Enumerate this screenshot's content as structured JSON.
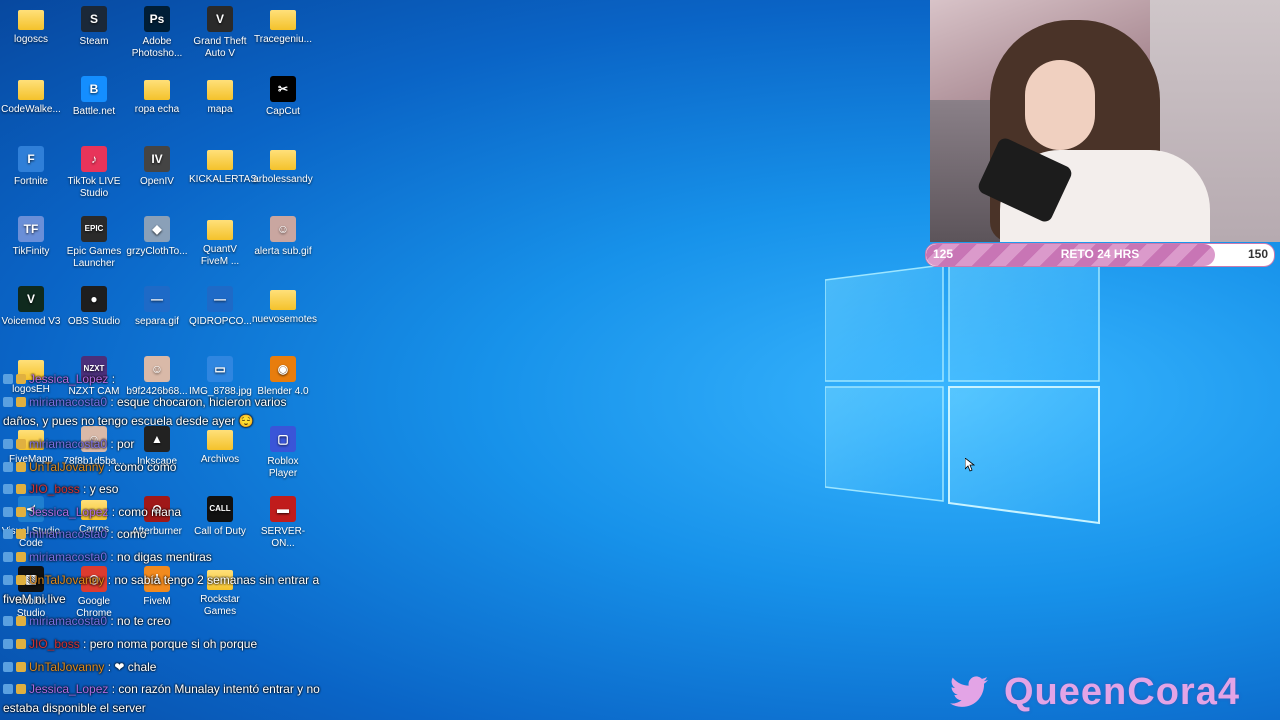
{
  "desktop_icons": [
    {
      "label": "logoscs",
      "type": "folder"
    },
    {
      "label": "Steam",
      "type": "app",
      "color": "#1b2838",
      "glyph": "S"
    },
    {
      "label": "Adobe Photosho...",
      "type": "app",
      "color": "#001e36",
      "glyph": "Ps"
    },
    {
      "label": "Grand Theft Auto V",
      "type": "app",
      "color": "#2a2a2a",
      "glyph": "V"
    },
    {
      "label": "Tracegeniu...",
      "type": "folder"
    },
    {
      "label": "CodeWalke...",
      "type": "folder"
    },
    {
      "label": "Battle.net",
      "type": "app",
      "color": "#148eff",
      "glyph": "B"
    },
    {
      "label": "ropa echa",
      "type": "folder"
    },
    {
      "label": "mapa",
      "type": "folder"
    },
    {
      "label": "CapCut",
      "type": "app",
      "color": "#000000",
      "glyph": "✂"
    },
    {
      "label": "Fortnite",
      "type": "app",
      "color": "#2f7fd8",
      "glyph": "F"
    },
    {
      "label": "TikTok LIVE Studio",
      "type": "app",
      "color": "#e8345a",
      "glyph": "♪"
    },
    {
      "label": "OpenIV",
      "type": "app",
      "color": "#444444",
      "glyph": "IV"
    },
    {
      "label": "KICKALERTAS",
      "type": "folder"
    },
    {
      "label": "arbolessandy",
      "type": "folder"
    },
    {
      "label": "TikFinity",
      "type": "app",
      "color": "#6a8fd8",
      "glyph": "TF"
    },
    {
      "label": "Epic Games Launcher",
      "type": "app",
      "color": "#2a2a2a",
      "glyph": "EPIC"
    },
    {
      "label": "grzyClothTo...",
      "type": "app",
      "color": "#8aa0b8",
      "glyph": "◆"
    },
    {
      "label": "QuantV FiveM ...",
      "type": "folder"
    },
    {
      "label": "alerta sub.gif",
      "type": "app",
      "color": "#c9a6a0",
      "glyph": "☺"
    },
    {
      "label": "Voicemod V3",
      "type": "app",
      "color": "#0f2a1e",
      "glyph": "V"
    },
    {
      "label": "OBS Studio",
      "type": "app",
      "color": "#1e1e1e",
      "glyph": "●"
    },
    {
      "label": "separa.gif",
      "type": "app",
      "color": "#1e6ac7",
      "glyph": "—"
    },
    {
      "label": "QIDROPCO...",
      "type": "app",
      "color": "#1e6ac7",
      "glyph": "—"
    },
    {
      "label": "nuevosemotes",
      "type": "folder"
    },
    {
      "label": "logosEH",
      "type": "folder"
    },
    {
      "label": "NZXT CAM",
      "type": "app",
      "color": "#4b2f7a",
      "glyph": "NZXT"
    },
    {
      "label": "b9f2426b68...",
      "type": "app",
      "color": "#d9b9a8",
      "glyph": "☺"
    },
    {
      "label": "IMG_8788.jpg",
      "type": "app",
      "color": "#2f86e0",
      "glyph": "▭"
    },
    {
      "label": "Blender 4.0",
      "type": "app",
      "color": "#e87d0d",
      "glyph": "◉"
    },
    {
      "label": "FiveMapp",
      "type": "folder"
    },
    {
      "label": "78f8b1d5ba...",
      "type": "app",
      "color": "#d9b9a8",
      "glyph": "☺"
    },
    {
      "label": "Inkscape",
      "type": "app",
      "color": "#222222",
      "glyph": "▲"
    },
    {
      "label": "Archivos",
      "type": "folder"
    },
    {
      "label": "Roblox Player",
      "type": "app",
      "color": "#3a55d8",
      "glyph": "▢"
    },
    {
      "label": "Visual Studio Code",
      "type": "app",
      "color": "#1f7fd0",
      "glyph": "≺"
    },
    {
      "label": "Carros",
      "type": "folder"
    },
    {
      "label": "Afterburner",
      "type": "app",
      "color": "#a01818",
      "glyph": "⊙"
    },
    {
      "label": "Call of Duty",
      "type": "app",
      "color": "#111111",
      "glyph": "CALL"
    },
    {
      "label": "SERVER-ON...",
      "type": "app",
      "color": "#c01c1c",
      "glyph": "▬"
    },
    {
      "label": "Roblox Studio",
      "type": "app",
      "color": "#111111",
      "glyph": "▧"
    },
    {
      "label": "Google Chrome",
      "type": "app",
      "color": "#dd3b2f",
      "glyph": "◎"
    },
    {
      "label": "FiveM",
      "type": "app",
      "color": "#f28a1e",
      "glyph": "⅄"
    },
    {
      "label": "Rockstar Games",
      "type": "folder"
    }
  ],
  "webcam": {
    "progress": {
      "current": "125",
      "label": "RETO 24 HRS",
      "goal": "150",
      "fraction": 0.83,
      "fill_color": "#c875b5"
    }
  },
  "chat": [
    {
      "user": "Jessica_Lopez",
      "text": " :",
      "user_class": "u-jess"
    },
    {
      "user": "miriamacosta0",
      "text": " : esque chocaron, hicieron varios",
      "user_class": "u-miriam"
    },
    {
      "user": "",
      "text": "daños, y pues no tengo escuela desde ayer 😌",
      "user_class": ""
    },
    {
      "user": "miriamacosta0",
      "text": " : por",
      "user_class": "u-miriam"
    },
    {
      "user": "UnTalJovanny",
      "text": " : como como",
      "user_class": "u-uni"
    },
    {
      "user": "JIO_boss",
      "text": " : y eso",
      "user_class": "u-jio"
    },
    {
      "user": "Jessica_Lopez",
      "text": " : como mana",
      "user_class": "u-jess"
    },
    {
      "user": "miriamacosta0",
      "text": " : como",
      "user_class": "u-miriam"
    },
    {
      "user": "miriamacosta0",
      "text": " : no digas mentiras",
      "user_class": "u-miriam"
    },
    {
      "user": "UnTalJovanny",
      "text": " : no sabía tengo 2 semanas sin entrar a",
      "user_class": "u-uni"
    },
    {
      "user": "",
      "text": "fiveM ni live",
      "user_class": ""
    },
    {
      "user": "miriamacosta0",
      "text": " : no te creo",
      "user_class": "u-miriam"
    },
    {
      "user": "JIO_boss",
      "text": " : pero noma porque si oh porque",
      "user_class": "u-jio"
    },
    {
      "user": "UnTalJovanny",
      "text": " : ❤ chale",
      "user_class": "u-uni"
    },
    {
      "user": "Jessica_Lopez",
      "text": " : con razón Munalay intentó entrar y no",
      "user_class": "u-jess"
    },
    {
      "user": "",
      "text": "estaba disponible el server",
      "user_class": ""
    }
  ],
  "brand": {
    "name": "QueenCora4",
    "icon": "twitter-icon",
    "color": "#e3a4e6"
  }
}
